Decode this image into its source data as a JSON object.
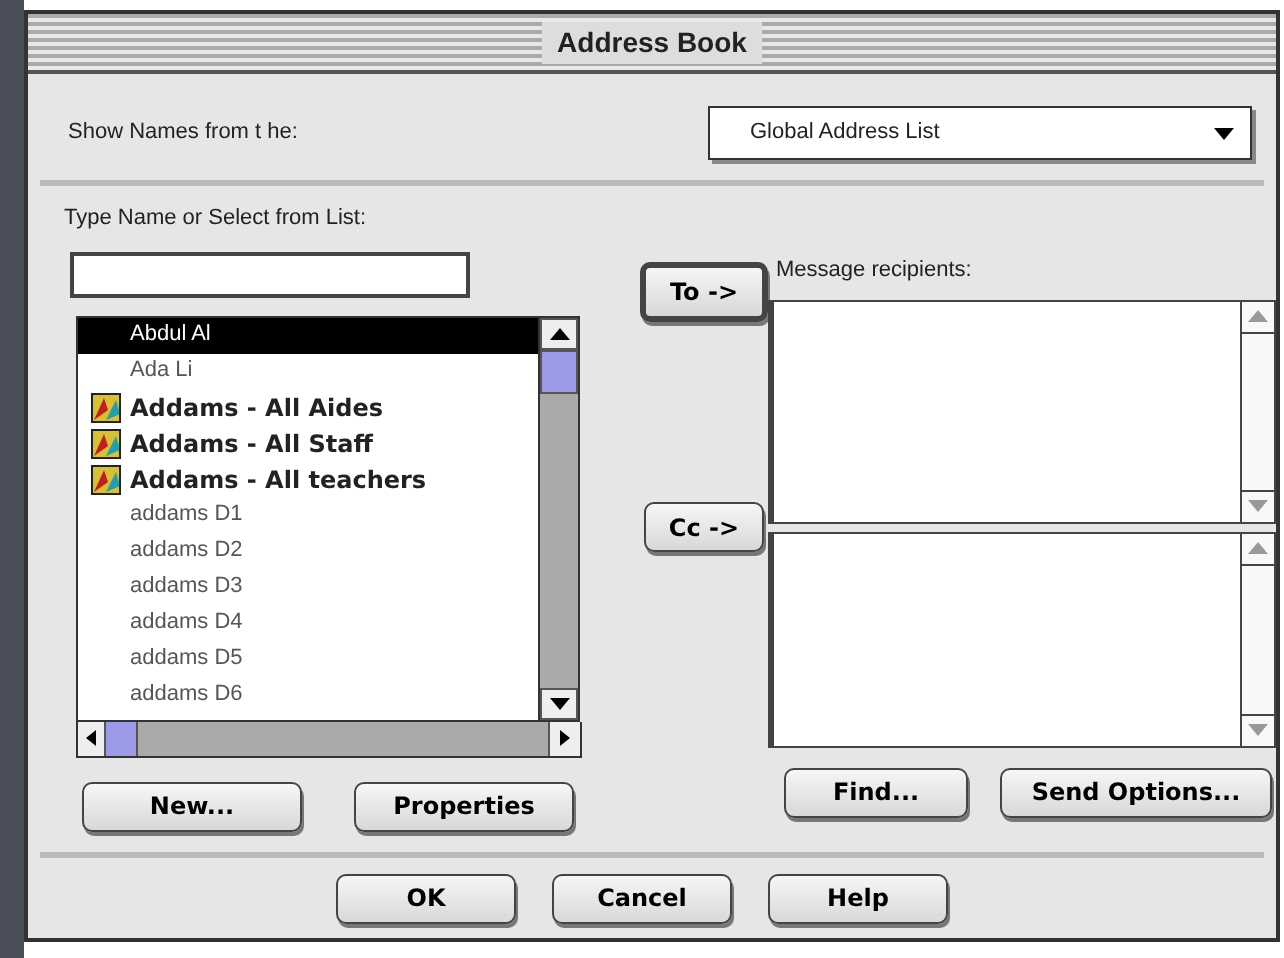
{
  "window": {
    "title": "Address Book"
  },
  "source": {
    "label": "Show Names from t he:",
    "value": "Global Address List"
  },
  "search": {
    "label": "Type Name or Select from List:"
  },
  "names": [
    {
      "name": "Abdul Al",
      "kind": "person",
      "selected": true
    },
    {
      "name": "Ada Li",
      "kind": "person",
      "selected": false
    },
    {
      "name": "Addams - All Aides",
      "kind": "group",
      "selected": false
    },
    {
      "name": "Addams - All Staff",
      "kind": "group",
      "selected": false
    },
    {
      "name": "Addams - All teachers",
      "kind": "group",
      "selected": false
    },
    {
      "name": "addams D1",
      "kind": "person",
      "selected": false
    },
    {
      "name": "addams D2",
      "kind": "person",
      "selected": false
    },
    {
      "name": "addams D3",
      "kind": "person",
      "selected": false
    },
    {
      "name": "addams D4",
      "kind": "person",
      "selected": false
    },
    {
      "name": "addams D5",
      "kind": "person",
      "selected": false
    },
    {
      "name": "addams D6",
      "kind": "person",
      "selected": false
    }
  ],
  "recipients": {
    "label": "Message recipients:",
    "to_button": "To ->",
    "cc_button": "Cc ->"
  },
  "list_buttons": [
    "New...",
    "Properties"
  ],
  "recipient_buttons": [
    "Find...",
    "Send Options..."
  ],
  "dialog_buttons": [
    "OK",
    "Cancel",
    "Help"
  ]
}
